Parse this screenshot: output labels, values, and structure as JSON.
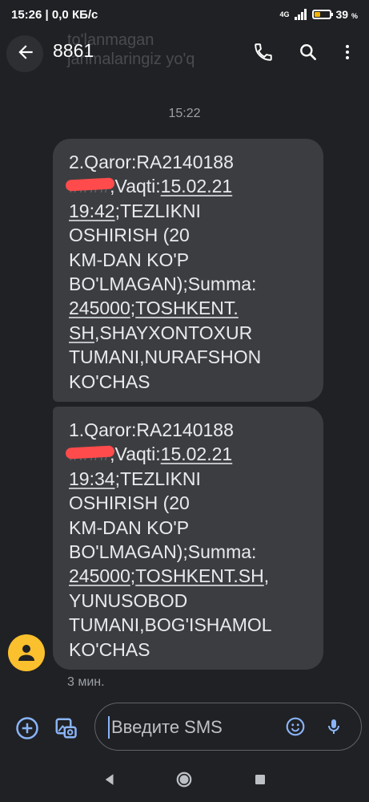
{
  "status_bar": {
    "time": "15:26",
    "speed": "0,0 КБ/с",
    "network": "4G",
    "battery_percent": "39",
    "battery_unit": "%",
    "battery_level": 0.39
  },
  "app_bar": {
    "title": "8861",
    "ghost_line1": "to'lanmagan",
    "ghost_line2": "jarimalaringiz yo'q"
  },
  "conversation": {
    "time_separator": "15:22",
    "messages": [
      {
        "lines": [
          [
            "2.Qaror:RA2140188"
          ],
          [
            "####",
            ";Vaqti:",
            "15.02.21"
          ],
          [
            "19:42",
            ";TEZLIKNI"
          ],
          [
            "OSHIRISH (20"
          ],
          [
            "KM-DAN KO'P"
          ],
          [
            "BO'LMAGAN);Summa:"
          ],
          [
            "245000",
            ";",
            "TOSHKENT."
          ],
          [
            "SH",
            ",SHAYXONTOXUR"
          ],
          [
            "TUMANI,NURAFSHON"
          ],
          [
            "KO'CHAS"
          ]
        ]
      },
      {
        "lines": [
          [
            "1.Qaror:RA2140188"
          ],
          [
            "####",
            ";Vaqti:",
            "15.02.21"
          ],
          [
            "19:34",
            ";TEZLIKNI"
          ],
          [
            "OSHIRISH (20"
          ],
          [
            "KM-DAN KO'P"
          ],
          [
            "BO'LMAGAN);Summa:"
          ],
          [
            "245000",
            ";",
            "TOSHKENT.SH",
            ","
          ],
          [
            "YUNUSOBOD"
          ],
          [
            "TUMANI,BOG'ISHAMOL"
          ],
          [
            "KO'CHAS"
          ]
        ]
      }
    ],
    "message_time": "3 мин."
  },
  "compose": {
    "placeholder": "Введите SMS"
  },
  "colors": {
    "background": "#202124",
    "bubble": "#3c3d41",
    "accent": "#8ab4f8",
    "avatar": "#fbc02d",
    "redaction": "#ff4b4b"
  },
  "icons": [
    "back-arrow-icon",
    "phone-icon",
    "search-icon",
    "more-vert-icon",
    "person-icon",
    "add-circle-icon",
    "gallery-icon",
    "emoji-icon",
    "mic-icon",
    "nav-back-icon",
    "nav-home-icon",
    "nav-recent-icon"
  ]
}
